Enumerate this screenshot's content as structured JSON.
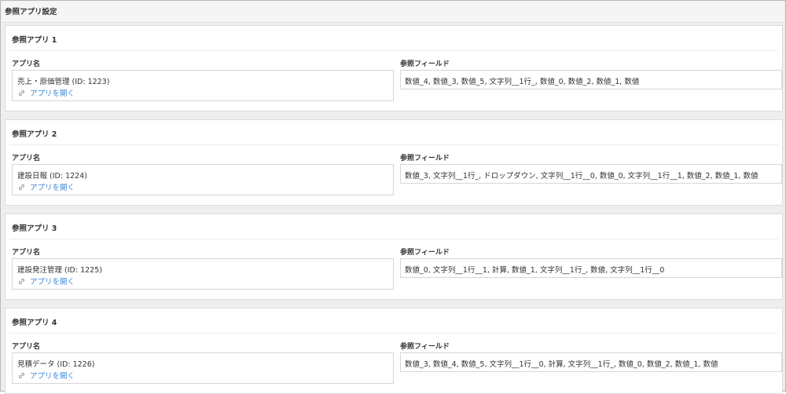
{
  "page": {
    "title": "参照アプリ設定"
  },
  "labels": {
    "app_name": "アプリ名",
    "ref_fields": "参照フィールド",
    "open_app": "アプリを開く"
  },
  "apps": [
    {
      "title": "参照アプリ 1",
      "app_name": "売上・原価管理 (ID: 1223)",
      "fields": "数値_4, 数値_3, 数値_5, 文字列__1行_, 数値_0, 数値_2, 数値_1, 数値"
    },
    {
      "title": "参照アプリ 2",
      "app_name": "建設日報 (ID: 1224)",
      "fields": "数値_3, 文字列__1行_, ドロップダウン, 文字列__1行__0, 数値_0, 文字列__1行__1, 数値_2, 数値_1, 数値"
    },
    {
      "title": "参照アプリ 3",
      "app_name": "建設発注管理 (ID: 1225)",
      "fields": "数値_0, 文字列__1行__1, 計算, 数値_1, 文字列__1行_, 数値, 文字列__1行__0"
    },
    {
      "title": "参照アプリ 4",
      "app_name": "見積データ (ID: 1226)",
      "fields": "数値_3, 数値_4, 数値_5, 文字列__1行__0, 計算, 文字列__1行_, 数値_0, 数値_2, 数値_1, 数値"
    }
  ],
  "colors": {
    "link": "#3b86d8",
    "background": "#eeeeee",
    "card": "#ffffff"
  },
  "icons": {
    "open_app": "link-icon"
  }
}
